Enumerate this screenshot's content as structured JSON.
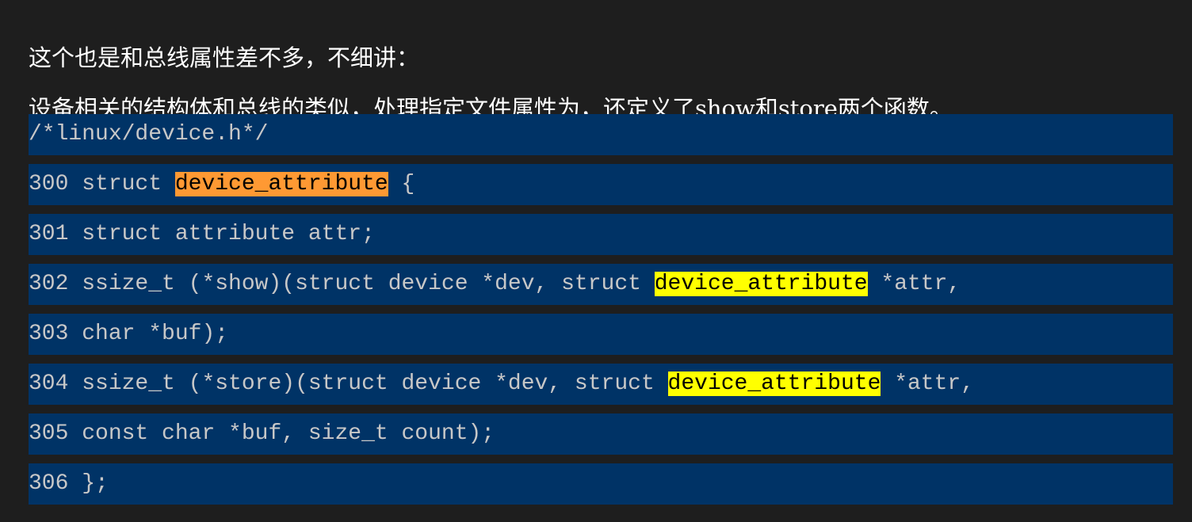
{
  "paragraphs": [
    "这个也是和总线属性差不多，不细讲：",
    "设备相关的结构体和总线的类似，处理指定文件属性为，还定义了show和store两个函数。"
  ],
  "colors": {
    "page_background": "#1e1e1e",
    "code_background": "#003366",
    "code_text": "#c8c8c8",
    "highlight_primary": "#ff9933",
    "highlight_secondary": "#ffff00"
  },
  "code": {
    "header_comment": "/*linux/device.h*/",
    "lines": [
      {
        "num": "300",
        "before": " struct ",
        "highlight": "device_attribute",
        "after": " {"
      },
      {
        "num": "301",
        "text": " struct attribute attr;"
      },
      {
        "num": "302",
        "before": " ssize_t (*show)(struct device *dev, struct ",
        "highlight": "device_attribute",
        "after": " *attr,"
      },
      {
        "num": "303",
        "text": " char *buf);"
      },
      {
        "num": "304",
        "before": " ssize_t (*store)(struct device *dev, struct ",
        "highlight": "device_attribute",
        "after": " *attr,"
      },
      {
        "num": "305",
        "text": " const char *buf, size_t count);"
      },
      {
        "num": "306",
        "text": " };"
      }
    ]
  }
}
